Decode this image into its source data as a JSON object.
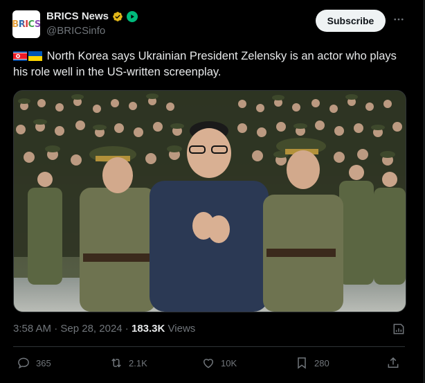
{
  "author": {
    "name": "BRICS News",
    "handle": "@BRICSinfo",
    "avatar_text": "BRICS"
  },
  "header": {
    "subscribe_label": "Subscribe",
    "more_icon": "more-horizontal-icon"
  },
  "post": {
    "text": "North Korea says Ukrainian President Zelensky is an actor who plays his role well in the US-written screenplay.",
    "flags": [
      "north-korea-flag",
      "ukraine-flag"
    ],
    "media_alt": ""
  },
  "meta": {
    "time": "3:58 AM",
    "separator": " · ",
    "date": "Sep 28, 2024",
    "views_count": "183.3K",
    "views_label": "Views"
  },
  "actions": {
    "replies": "365",
    "reposts": "2.1K",
    "likes": "10K",
    "bookmarks": "280"
  },
  "colors": {
    "background": "#000000",
    "text": "#e7e9ea",
    "muted": "#71767b",
    "verified_gold": "#e2b719",
    "subscribe_bg": "#eff3f4"
  }
}
